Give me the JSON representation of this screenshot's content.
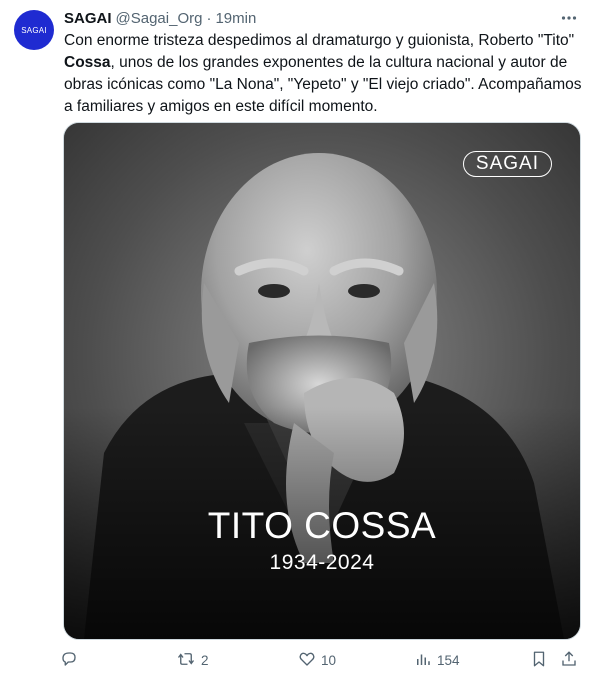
{
  "tweet": {
    "author": {
      "avatar_text": "SAGAI",
      "name": "SAGAI",
      "handle": "@Sagai_Org",
      "separator": "·",
      "time": "19min"
    },
    "text": {
      "part1": "Con enorme tristeza despedimos al dramaturgo y guionista, Roberto \"Tito\" ",
      "bold": "Cossa",
      "part2": ", unos de los grandes exponentes de la cultura nacional y autor de obras icónicas como \"La Nona\", \"Yepeto\" y \"El viejo criado\". Acompañamos a familiares y amigos en este difícil momento."
    },
    "media": {
      "badge": "SAGAI",
      "name": "TITO COSSA",
      "years": "1934-2024"
    },
    "actions": {
      "reply": {
        "icon": "reply-icon",
        "count": ""
      },
      "retweet": {
        "icon": "retweet-icon",
        "count": "2"
      },
      "like": {
        "icon": "heart-icon",
        "count": "10"
      },
      "views": {
        "icon": "views-icon",
        "count": "154"
      },
      "bookmark": {
        "icon": "bookmark-icon"
      },
      "share": {
        "icon": "share-icon"
      }
    },
    "colors": {
      "avatar_bg": "#1f2bd1",
      "text": "#0f1419",
      "secondary": "#536471"
    }
  }
}
